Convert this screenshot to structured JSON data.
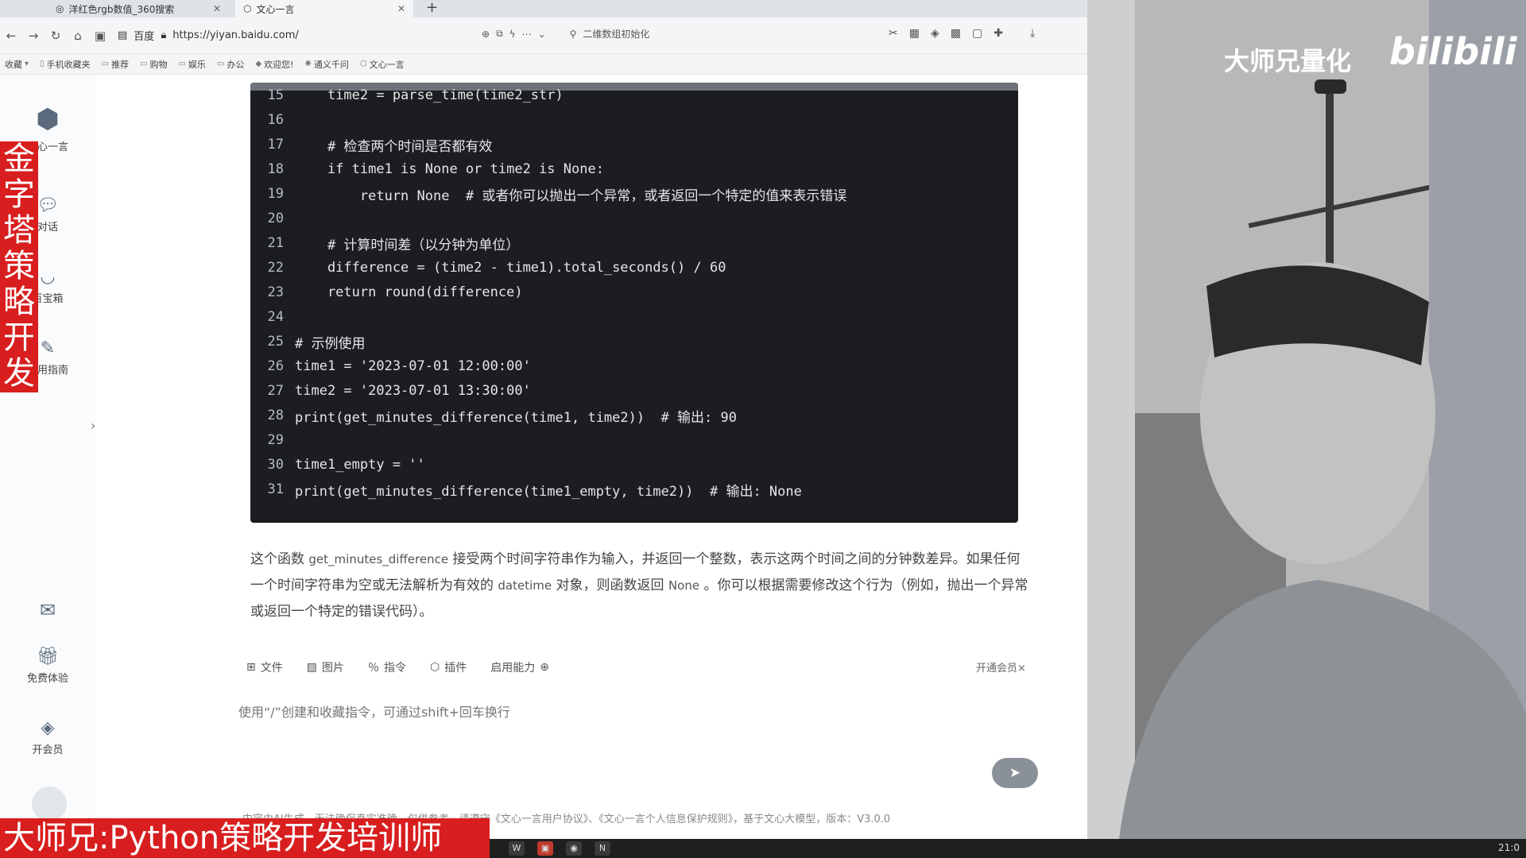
{
  "tabs": [
    {
      "label": "洋红色rgb数值_360搜索",
      "active": false
    },
    {
      "label": "文心一言",
      "active": true
    }
  ],
  "toolbar": {
    "home_label": "百度",
    "url": "https://yiyan.baidu.com/",
    "search_text": "二维数组初始化"
  },
  "bookmarks": [
    "收藏",
    "手机收藏夹",
    "推荐",
    "购物",
    "娱乐",
    "办公",
    "欢迎您!",
    "通义千问",
    "文心一言"
  ],
  "sidebar": {
    "items": [
      {
        "label": "文心一言",
        "icon": "yiyan-logo-icon"
      },
      {
        "label": "对话",
        "icon": "chat-icon"
      },
      {
        "label": "百宝箱",
        "icon": "toolbox-icon"
      },
      {
        "label": "使用指南",
        "icon": "guide-icon"
      },
      {
        "label": "免费体验",
        "icon": "gift-icon"
      },
      {
        "label": "开会员",
        "icon": "diamond-icon"
      }
    ]
  },
  "code": {
    "lines": [
      {
        "n": "15",
        "text": "    time2 = parse_time(time2_str)"
      },
      {
        "n": "16",
        "text": ""
      },
      {
        "n": "17",
        "text": "    # 检查两个时间是否都有效"
      },
      {
        "n": "18",
        "text": "    if time1 is None or time2 is None:"
      },
      {
        "n": "19",
        "text": "        return None  # 或者你可以抛出一个异常，或者返回一个特定的值来表示错误"
      },
      {
        "n": "20",
        "text": ""
      },
      {
        "n": "21",
        "text": "    # 计算时间差（以分钟为单位）"
      },
      {
        "n": "22",
        "text": "    difference = (time2 - time1).total_seconds() / 60"
      },
      {
        "n": "23",
        "text": "    return round(difference)"
      },
      {
        "n": "24",
        "text": ""
      },
      {
        "n": "25",
        "text": "# 示例使用"
      },
      {
        "n": "26",
        "text": "time1 = '2023-07-01 12:00:00'"
      },
      {
        "n": "27",
        "text": "time2 = '2023-07-01 13:30:00'"
      },
      {
        "n": "28",
        "text": "print(get_minutes_difference(time1, time2))  # 输出: 90"
      },
      {
        "n": "29",
        "text": ""
      },
      {
        "n": "30",
        "text": "time1_empty = ''"
      },
      {
        "n": "31",
        "text": "print(get_minutes_difference(time1_empty, time2))  # 输出: None"
      }
    ]
  },
  "description": {
    "p1": "这个函数 ",
    "func": "get_minutes_difference",
    "p2": " 接受两个时间字符串作为输入，并返回一个整数，表示这两个时间之间的分钟数差异。如果任何一个时间字符串为空或无法解析为有效的 ",
    "datetime": "datetime",
    "p3": " 对象，则函数返回 ",
    "none": "None",
    "p4": " 。你可以根据需要修改这个行为（例如，抛出一个异常或返回一个特定的错误代码）。"
  },
  "input_tools": [
    "文件",
    "图片",
    "指令",
    "插件",
    "启用能力"
  ],
  "vip_link": "开通会员×",
  "chat_input_placeholder": "使用“/”创建和收藏指令，可通过shift+回车换行",
  "footer": "内容由AI生成，无法确保真实准确，仅供参考，请遵守《文心一言用户协议》、《文心一言个人信息保护规则》，基于文心大模型，版本：V3.0.0",
  "overlays": {
    "vertical_banner": [
      "金",
      "字",
      "塔",
      "策",
      "略",
      "开",
      "发"
    ],
    "bottom_banner": "大师兄:Python策略开发培训师",
    "cam_title": "大师兄量化",
    "cam_logo": "bilibili"
  },
  "taskbar": {
    "clock": "21:0"
  },
  "colors": {
    "banner_red": "#d81e1e",
    "code_bg": "#1b1d22",
    "send_btn": "#8a9098"
  }
}
